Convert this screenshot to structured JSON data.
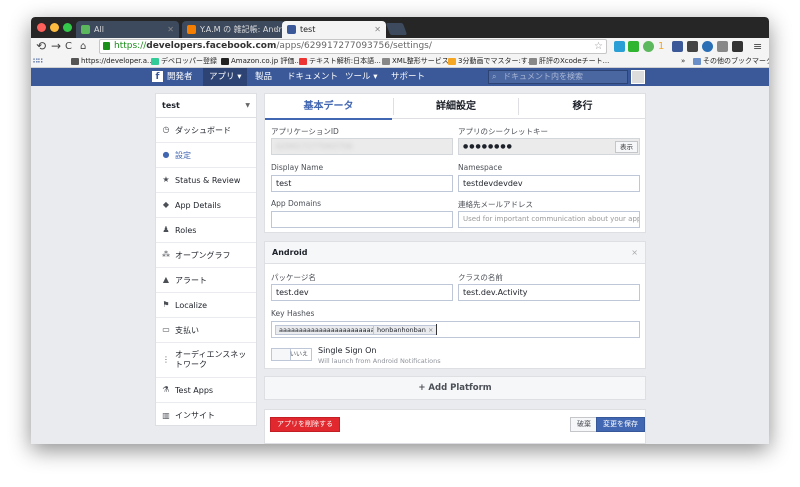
{
  "browser": {
    "tabs": [
      {
        "label": "All",
        "fav_color": "#5cb85c"
      },
      {
        "label": "Y.A.M の 雑記帳: Android",
        "fav_color": "#f57d00"
      },
      {
        "label": "test",
        "fav_color": "#3b5998"
      }
    ],
    "url_scheme": "https://",
    "url_host": "developers.facebook.com",
    "url_path": "/apps/629917277093756/settings/",
    "bookmarks": [
      {
        "label": "https://developer.a...",
        "color": "#555"
      },
      {
        "label": "デベロッパー登録",
        "color": "#3c9"
      },
      {
        "label": "Amazon.co.jp 評価...",
        "color": "#222"
      },
      {
        "label": "テキスト解析:日本語...",
        "color": "#e33"
      },
      {
        "label": "XML整形サービス",
        "color": "#888"
      },
      {
        "label": "3分動画でマスター:す...",
        "color": "#f5a623"
      },
      {
        "label": "肝評のXcodeチート...",
        "color": "#888"
      }
    ],
    "bookmarks_more": "»",
    "bookmarks_other": "その他のブックマーク"
  },
  "fb_nav": {
    "logo": "f",
    "brand": "開発者",
    "items": [
      "アプリ ▾",
      "製品",
      "ドキュメント",
      "ツール ▾",
      "サポート"
    ],
    "search_placeholder": "ドキュメント内を検索"
  },
  "sidebar": {
    "app_name": "test",
    "items": [
      {
        "label": "ダッシュボード",
        "icon": "◷"
      },
      {
        "label": "設定",
        "icon": "●"
      },
      {
        "label": "Status & Review",
        "icon": "★"
      },
      {
        "label": "App Details",
        "icon": "◆"
      },
      {
        "label": "Roles",
        "icon": "♟"
      },
      {
        "label": "オープングラフ",
        "icon": "⁂"
      },
      {
        "label": "アラート",
        "icon": "▲"
      },
      {
        "label": "Localize",
        "icon": "⚑"
      },
      {
        "label": "支払い",
        "icon": "▭"
      },
      {
        "label": "オーディエンスネットワーク",
        "icon": "⋮"
      },
      {
        "label": "Test Apps",
        "icon": "⚗"
      },
      {
        "label": "インサイト",
        "icon": "▥"
      }
    ]
  },
  "settings": {
    "tabs": [
      "基本データ",
      "詳細設定",
      "移行"
    ],
    "app_id_label": "アプリケーションID",
    "app_id_value": "629917277093756",
    "secret_label": "アプリのシークレットキー",
    "secret_value": "●●●●●●●●",
    "secret_show": "表示",
    "display_name_label": "Display Name",
    "display_name_value": "test",
    "namespace_label": "Namespace",
    "namespace_value": "testdevdevdev",
    "app_domains_label": "App Domains",
    "app_domains_value": "",
    "contact_email_label": "連絡先メールアドレス",
    "contact_email_placeholder": "Used for important communication about your app"
  },
  "android": {
    "title": "Android",
    "close": "×",
    "package_label": "パッケージ名",
    "package_value": "test.dev",
    "class_label": "クラスの名前",
    "class_value": "test.dev.Activity",
    "key_hashes_label": "Key Hashes",
    "key_hashes": [
      "aaaaaaaaaaaaaaaaaaaaaaaa",
      "honbanhonban"
    ],
    "sso_label": "Single Sign On",
    "sso_desc": "Will launch from Android Notifications",
    "sso_toggle": "いいえ"
  },
  "add_platform": "+ Add Platform",
  "footer": {
    "delete": "アプリを削除する",
    "discard": "破棄",
    "save": "変更を保存"
  },
  "colors": {
    "fb_blue": "#3b5998",
    "link_blue": "#4267b2",
    "delete_red": "#e0282e"
  }
}
